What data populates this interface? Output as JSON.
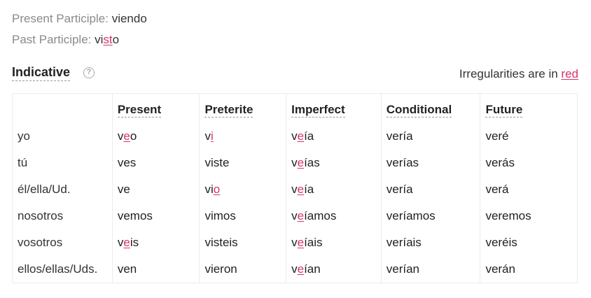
{
  "participles": {
    "present_label": "Present Participle:",
    "present_value": "viendo",
    "past_label": "Past Participle:",
    "past_value": {
      "pre": "vi",
      "irr": "st",
      "post": "o"
    }
  },
  "section": {
    "title": "Indicative",
    "help_icon": "question-circle-icon",
    "legend_text": "Irregularities are in",
    "legend_link": "red"
  },
  "colors": {
    "irregular": "#d6336c",
    "text": "#333333",
    "muted": "#8a8a8a"
  },
  "table": {
    "headers": [
      "",
      "Present",
      "Preterite",
      "Imperfect",
      "Conditional",
      "Future"
    ],
    "rows": [
      {
        "pronoun": "yo",
        "cells": [
          {
            "pre": "v",
            "irr": "e",
            "post": "o"
          },
          {
            "pre": "v",
            "irr": "i",
            "post": ""
          },
          {
            "pre": "v",
            "irr": "e",
            "post": "ía"
          },
          {
            "pre": "vería",
            "irr": "",
            "post": ""
          },
          {
            "pre": "veré",
            "irr": "",
            "post": ""
          }
        ]
      },
      {
        "pronoun": "tú",
        "cells": [
          {
            "pre": "ves",
            "irr": "",
            "post": ""
          },
          {
            "pre": "viste",
            "irr": "",
            "post": ""
          },
          {
            "pre": "v",
            "irr": "e",
            "post": "ías"
          },
          {
            "pre": "verías",
            "irr": "",
            "post": ""
          },
          {
            "pre": "verás",
            "irr": "",
            "post": ""
          }
        ]
      },
      {
        "pronoun": "él/ella/Ud.",
        "cells": [
          {
            "pre": "ve",
            "irr": "",
            "post": ""
          },
          {
            "pre": "vi",
            "irr": "o",
            "post": ""
          },
          {
            "pre": "v",
            "irr": "e",
            "post": "ía"
          },
          {
            "pre": "vería",
            "irr": "",
            "post": ""
          },
          {
            "pre": "verá",
            "irr": "",
            "post": ""
          }
        ]
      },
      {
        "pronoun": "nosotros",
        "cells": [
          {
            "pre": "vemos",
            "irr": "",
            "post": ""
          },
          {
            "pre": "vimos",
            "irr": "",
            "post": ""
          },
          {
            "pre": "v",
            "irr": "e",
            "post": "íamos"
          },
          {
            "pre": "veríamos",
            "irr": "",
            "post": ""
          },
          {
            "pre": "veremos",
            "irr": "",
            "post": ""
          }
        ]
      },
      {
        "pronoun": "vosotros",
        "cells": [
          {
            "pre": "v",
            "irr": "e",
            "post": "is"
          },
          {
            "pre": "visteis",
            "irr": "",
            "post": ""
          },
          {
            "pre": "v",
            "irr": "e",
            "post": "íais"
          },
          {
            "pre": "veríais",
            "irr": "",
            "post": ""
          },
          {
            "pre": "veréis",
            "irr": "",
            "post": ""
          }
        ]
      },
      {
        "pronoun": "ellos/ellas/Uds.",
        "cells": [
          {
            "pre": "ven",
            "irr": "",
            "post": ""
          },
          {
            "pre": "vieron",
            "irr": "",
            "post": ""
          },
          {
            "pre": "v",
            "irr": "e",
            "post": "ían"
          },
          {
            "pre": "verían",
            "irr": "",
            "post": ""
          },
          {
            "pre": "verán",
            "irr": "",
            "post": ""
          }
        ]
      }
    ]
  }
}
